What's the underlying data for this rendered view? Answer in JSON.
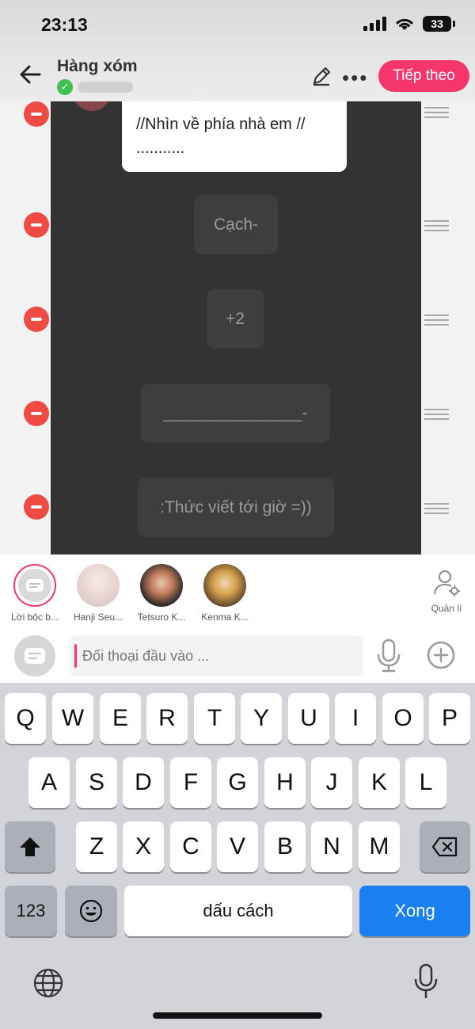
{
  "status_bar": {
    "time": "23:13",
    "battery": "33"
  },
  "header": {
    "title": "Hàng xóm",
    "next_label": "Tiếp theo"
  },
  "story": {
    "dialogue_text": "//Nhìn về phía nhà em //\n...........",
    "narrations": [
      "Cạch-",
      "+2",
      "_______________-",
      ":Thức viết tới giờ =))"
    ]
  },
  "characters": [
    {
      "name": "Lời bộc b..."
    },
    {
      "name": "Hanji Seu..."
    },
    {
      "name": "Tetsuro K..."
    },
    {
      "name": "Kenma K..."
    }
  ],
  "manage_label": "Quản lí",
  "input": {
    "placeholder": "Đối thoại đầu vào ..."
  },
  "keyboard": {
    "row1": [
      "Q",
      "W",
      "E",
      "R",
      "T",
      "Y",
      "U",
      "I",
      "O",
      "P"
    ],
    "row2": [
      "A",
      "S",
      "D",
      "F",
      "G",
      "H",
      "J",
      "K",
      "L"
    ],
    "row3": [
      "Z",
      "X",
      "C",
      "V",
      "B",
      "N",
      "M"
    ],
    "numbers_label": "123",
    "space_label": "dấu cách",
    "done_label": "Xong"
  },
  "colors": {
    "accent": "#f5366c",
    "remove": "#ef4a43",
    "done_key": "#1a7ff0"
  }
}
